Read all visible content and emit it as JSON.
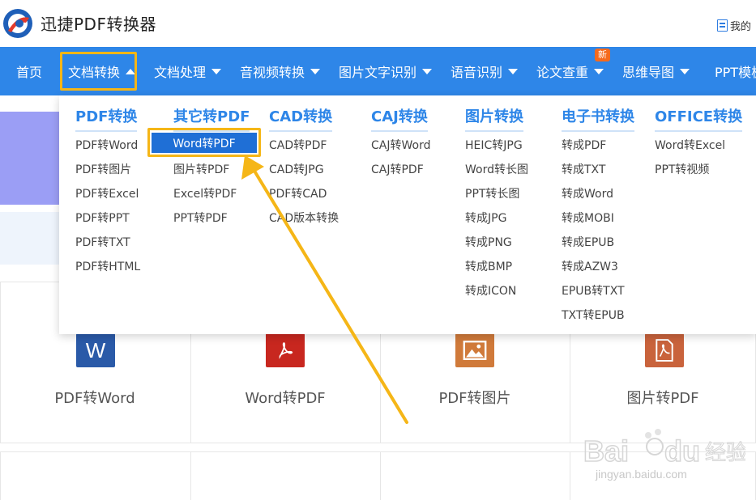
{
  "app": {
    "title": "迅捷PDF转换器"
  },
  "header": {
    "my_link": "我的"
  },
  "nav": {
    "items": [
      {
        "label": "首页"
      },
      {
        "label": "文档转换"
      },
      {
        "label": "文档处理"
      },
      {
        "label": "音视频转换"
      },
      {
        "label": "图片文字识别"
      },
      {
        "label": "语音识别"
      },
      {
        "label": "论文查重"
      },
      {
        "label": "思维导图"
      },
      {
        "label": "PPT模板"
      }
    ],
    "badge": "新"
  },
  "dropdown": {
    "columns": [
      {
        "heading": "PDF转换",
        "items": [
          "PDF转Word",
          "PDF转图片",
          "PDF转Excel",
          "PDF转PPT",
          "PDF转TXT",
          "PDF转HTML"
        ]
      },
      {
        "heading": "其它转PDF",
        "items": [
          "Word转PDF",
          "图片转PDF",
          "Excel转PDF",
          "PPT转PDF"
        ]
      },
      {
        "heading": "CAD转换",
        "items": [
          "CAD转PDF",
          "CAD转JPG",
          "PDF转CAD",
          "CAD版本转换"
        ]
      },
      {
        "heading": "CAJ转换",
        "items": [
          "CAJ转Word",
          "CAJ转PDF"
        ]
      },
      {
        "heading": "图片转换",
        "items": [
          "HEIC转JPG",
          "Word转长图",
          "PPT转长图",
          "转成JPG",
          "转成PNG",
          "转成BMP",
          "转成ICON"
        ]
      },
      {
        "heading": "电子书转换",
        "items": [
          "转成PDF",
          "转成TXT",
          "转成Word",
          "转成MOBI",
          "转成EPUB",
          "转成AZW3",
          "EPUB转TXT",
          "TXT转EPUB"
        ]
      },
      {
        "heading": "OFFICE转换",
        "items": [
          "Word转Excel",
          "PPT转视频"
        ]
      }
    ]
  },
  "cards": [
    {
      "label": "PDF转Word",
      "icon": "word-icon",
      "glyph": "W",
      "color": "#2a5aa8"
    },
    {
      "label": "Word转PDF",
      "icon": "pdf-icon",
      "glyph": "",
      "color": "#c8271f"
    },
    {
      "label": "PDF转图片",
      "icon": "image-icon",
      "glyph": "",
      "color": "#d07a3a"
    },
    {
      "label": "图片转PDF",
      "icon": "pdf-icon",
      "glyph": "",
      "color": "#c9633c"
    }
  ],
  "watermark": {
    "url": "jingyan.baidu.com",
    "brand": "Baidu经验"
  }
}
